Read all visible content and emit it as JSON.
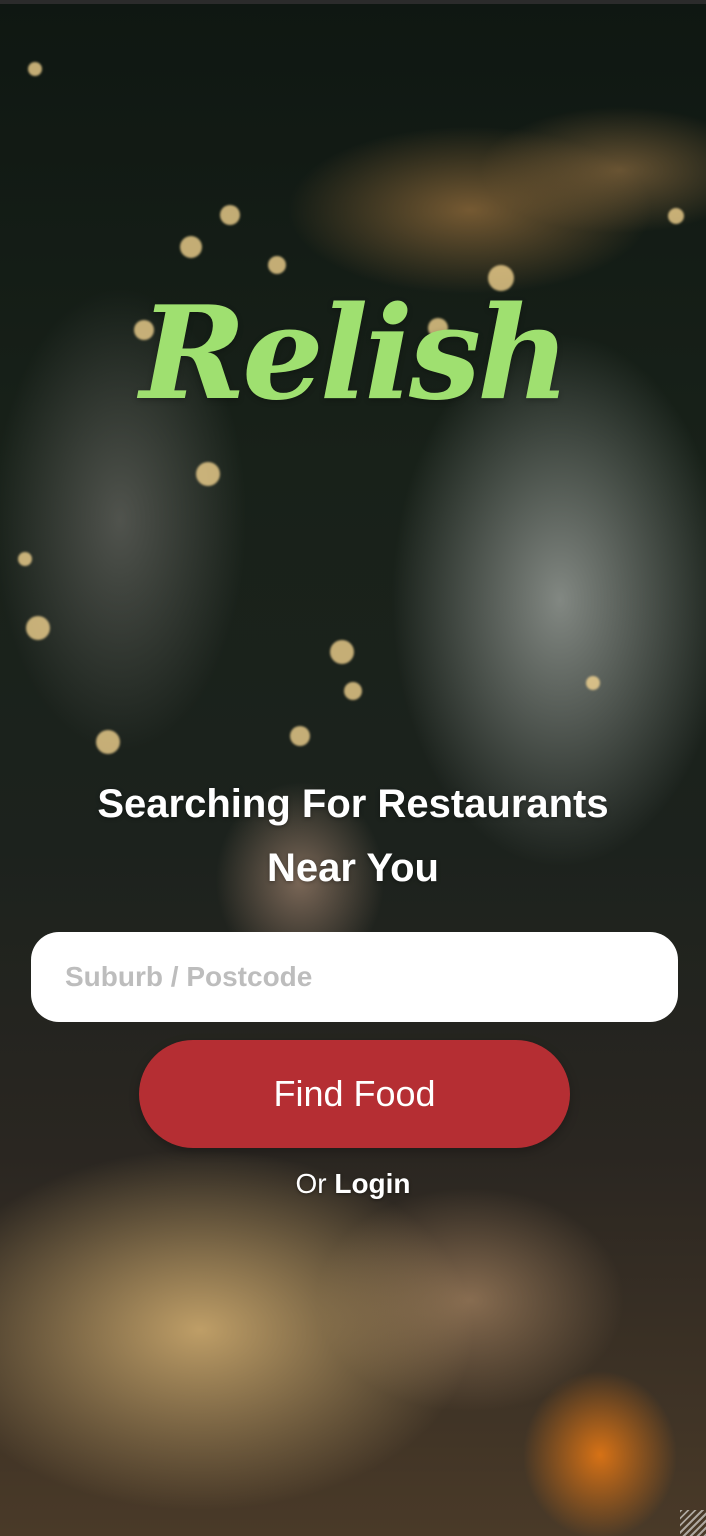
{
  "brand": {
    "logo_text": "Relish",
    "logo_color": "#9fe070"
  },
  "hero": {
    "headline_line1": "Searching For Restaurants",
    "headline_line2": "Near You"
  },
  "search": {
    "placeholder": "Suburb / Postcode",
    "value": ""
  },
  "actions": {
    "find_food_label": "Find Food",
    "find_food_color": "#b52e33",
    "or_text": "Or",
    "login_label": "Login"
  }
}
